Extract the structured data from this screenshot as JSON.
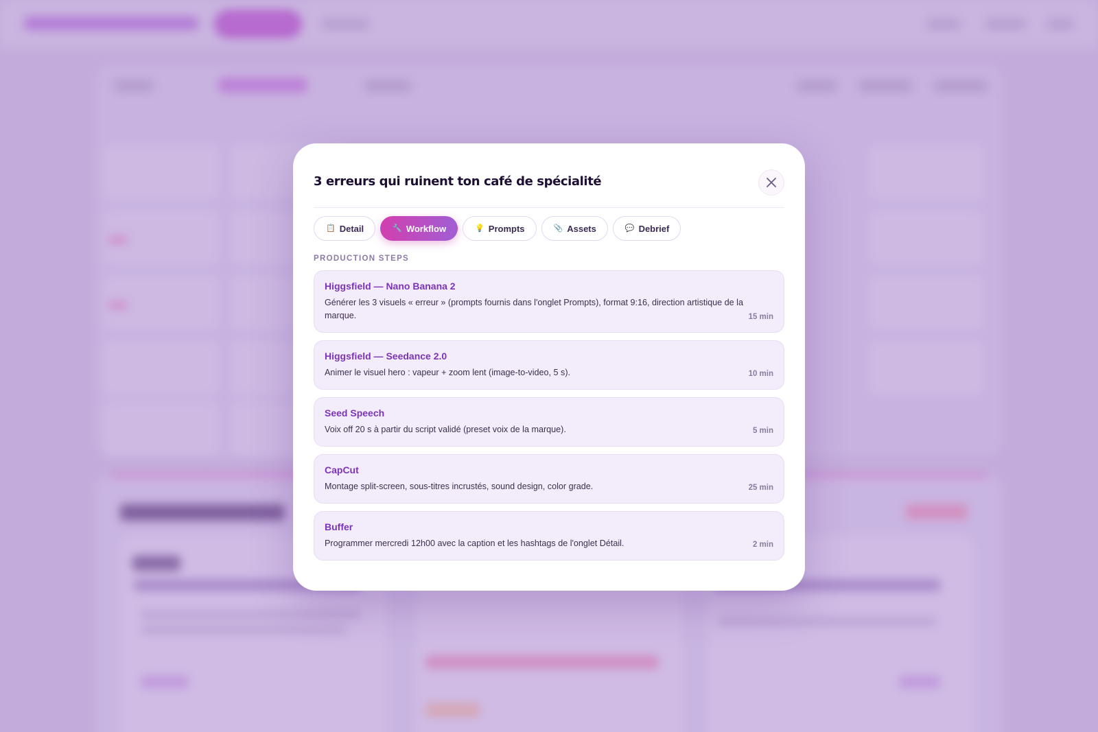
{
  "modal": {
    "title": "3 erreurs qui ruinent ton café de spécialité",
    "close_icon": "close-icon",
    "tabs": [
      {
        "label": "Detail",
        "icon": "clipboard-icon",
        "glyph": "📋",
        "active": false
      },
      {
        "label": "Workflow",
        "icon": "wrench-icon",
        "glyph": "🔧",
        "active": true
      },
      {
        "label": "Prompts",
        "icon": "bulb-icon",
        "glyph": "💡",
        "active": false
      },
      {
        "label": "Assets",
        "icon": "paperclip-icon",
        "glyph": "📎",
        "active": false
      },
      {
        "label": "Debrief",
        "icon": "speech-bubble-icon",
        "glyph": "💬",
        "active": false
      }
    ],
    "section_label": "PRODUCTION STEPS",
    "steps": [
      {
        "title": "Higgsfield — Nano Banana 2",
        "desc": "Générer les 3 visuels « erreur » (prompts fournis dans l'onglet Prompts), format 9:16, direction artistique de la marque.",
        "time": "15 min"
      },
      {
        "title": "Higgsfield — Seedance 2.0",
        "desc": "Animer le visuel hero : vapeur + zoom lent (image-to-video, 5 s).",
        "time": "10 min"
      },
      {
        "title": "Seed Speech",
        "desc": "Voix off 20 s à partir du script validé (preset voix de la marque).",
        "time": "5 min"
      },
      {
        "title": "CapCut",
        "desc": "Montage split-screen, sous-titres incrustés, sound design, color grade.",
        "time": "25 min"
      },
      {
        "title": "Buffer",
        "desc": "Programmer mercredi 12h00 avec la caption et les hashtags de l'onglet Détail.",
        "time": "2 min"
      }
    ]
  },
  "colors": {
    "accent_gradient_start": "#d23fae",
    "accent_gradient_end": "#a05ed4",
    "step_title": "#7b34b8",
    "step_bg": "#f3ecfa",
    "backdrop": "#cbb9de"
  }
}
